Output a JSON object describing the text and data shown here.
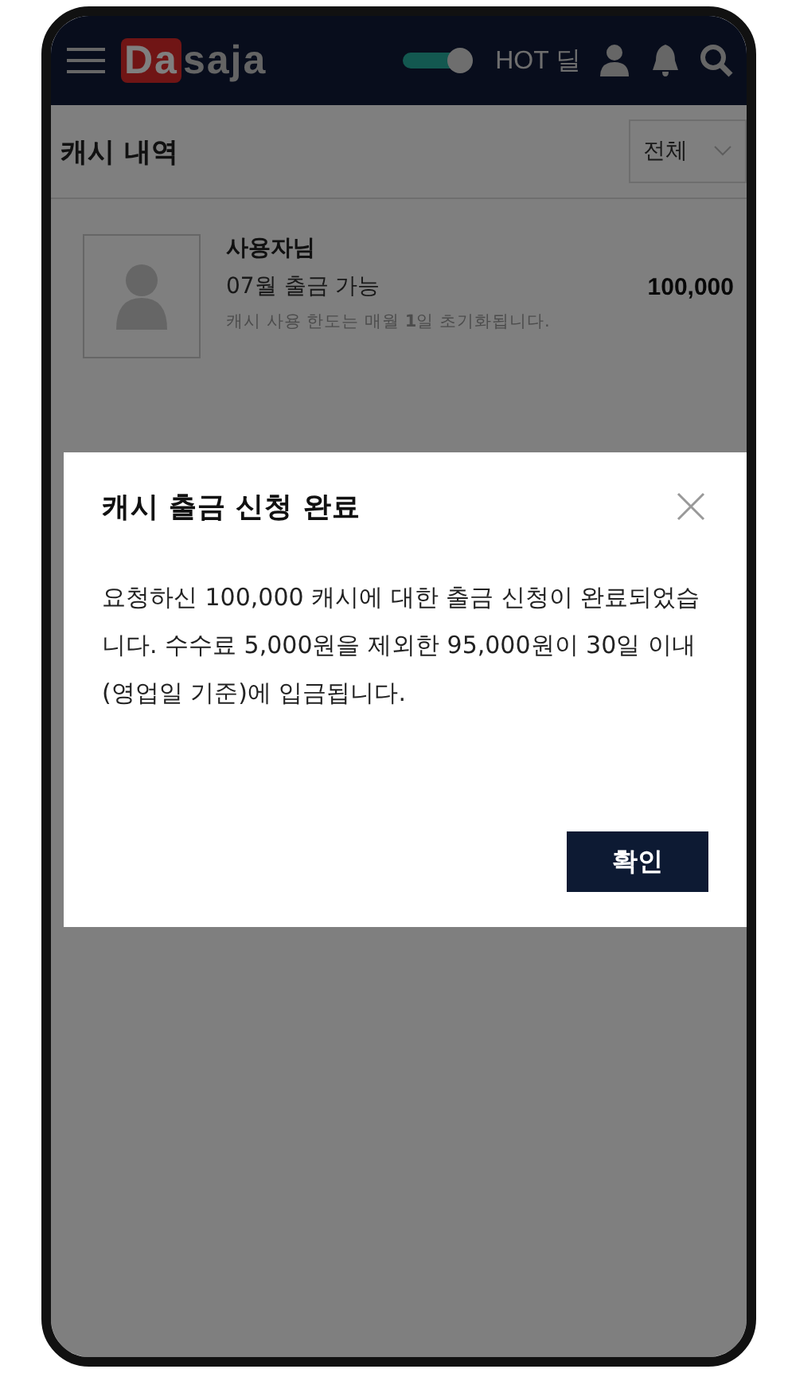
{
  "header": {
    "logo_accent": "Da",
    "logo_rest": "saja",
    "toggle": {
      "on": true
    },
    "hot_label": "HOT 딜"
  },
  "section": {
    "title": "캐시 내역",
    "filter": "전체"
  },
  "account": {
    "name": "사용자님",
    "label": "07월 출금 가능",
    "amount": "100,000",
    "note": "캐시 사용 한도는 매월 **1**일 초기화됩니다."
  },
  "dialog": {
    "title": "캐시 출금 신청 완료",
    "message": "요청하신 100,000 캐시에 대한 출금 신청이 완료되었습니다. 수수료 5,000원을 제외한 95,000원이 30일 이내(영업일 기준)에 입금됩니다.",
    "confirm": "확인"
  }
}
